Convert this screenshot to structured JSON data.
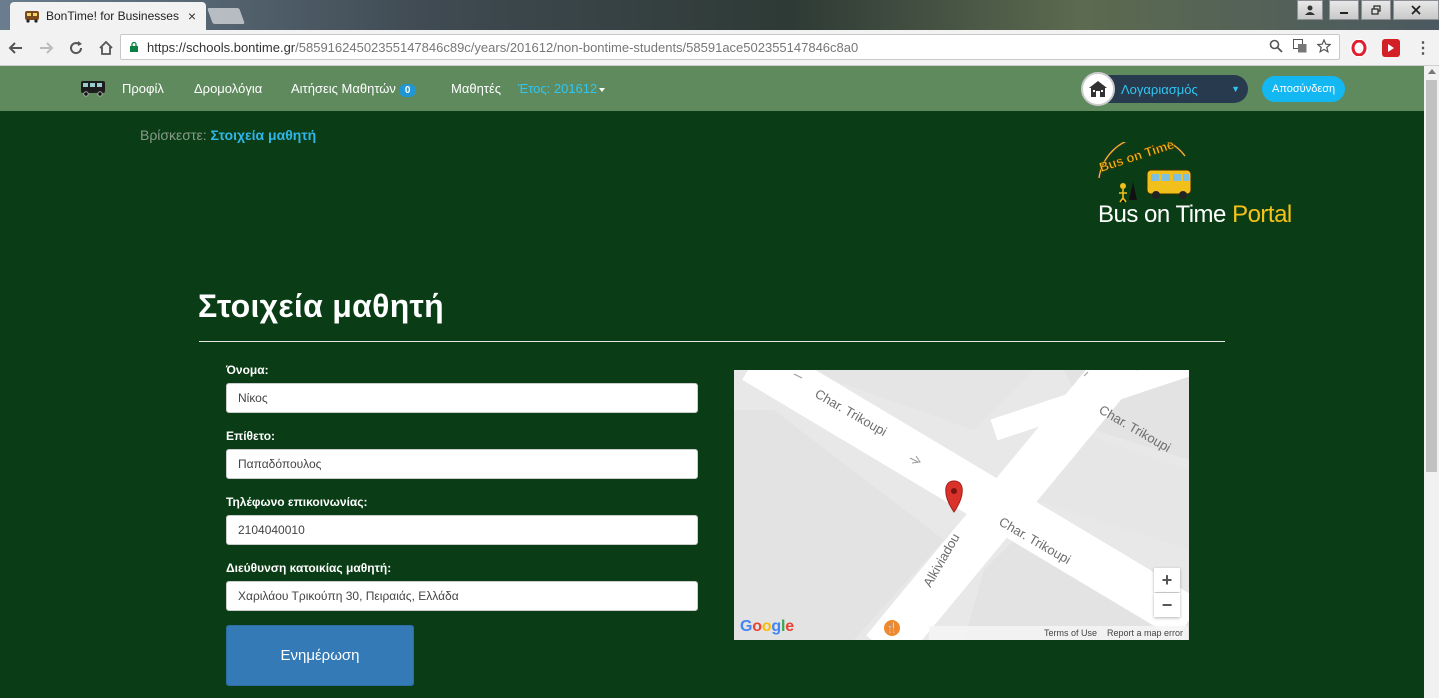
{
  "browser": {
    "tab_title": "BonTime! for Businesses",
    "tab_close": "×",
    "url_host": "https://schools.bontime.gr",
    "url_path": "/58591624502355147846c89c/years/201612/non-bontime-students/58591ace502355147846c8a0",
    "back_icon": "back-arrow-icon",
    "forward_icon": "forward-arrow-icon",
    "reload_icon": "reload-icon",
    "home_icon": "home-icon",
    "menu_icon": "kebab-menu-icon"
  },
  "nav": {
    "items": [
      "Προφίλ",
      "Δρομολόγια",
      "Αιτήσεις Μαθητών",
      "Μαθητές"
    ],
    "requests_badge": "0",
    "year_label": "Έτος: 201612",
    "account_label": "Λογαριασμός",
    "logout_label": "Αποσύνδεση"
  },
  "breadcrumb": {
    "prefix": "Βρίσκεστε:",
    "current": "Στοιχεία μαθητή"
  },
  "brand": {
    "badge_text": "Bus on Time",
    "portal_main": "Bus on Time ",
    "portal_accent": "Portal"
  },
  "page": {
    "title": "Στοιχεία μαθητή"
  },
  "form": {
    "first_name": {
      "label": "Όνομα:",
      "value": "Νίκος"
    },
    "last_name": {
      "label": "Επίθετο:",
      "value": "Παπαδόπουλος"
    },
    "phone": {
      "label": "Τηλέφωνο επικοινωνίας:",
      "value": "2104040010"
    },
    "address": {
      "label": "Διεύθυνση κατοικίας μαθητή:",
      "value": "Χαριλάου Τρικούπη 30, Πειραιάς, Ελλάδα"
    },
    "submit_label": "Ενημέρωση"
  },
  "map": {
    "streets": [
      "Char. Trikoupi",
      "Char. Trikoupi",
      "Char. Trikoupi",
      "Alkiviadou"
    ],
    "zoom_in": "+",
    "zoom_out": "−",
    "google_logo": [
      "G",
      "o",
      "o",
      "g",
      "l",
      "e"
    ],
    "terms": "Terms of Use",
    "report": "Report a map error",
    "colors": {
      "pin": "#d9322a",
      "road": "#ffffff",
      "block": "#e3e3e3"
    }
  }
}
